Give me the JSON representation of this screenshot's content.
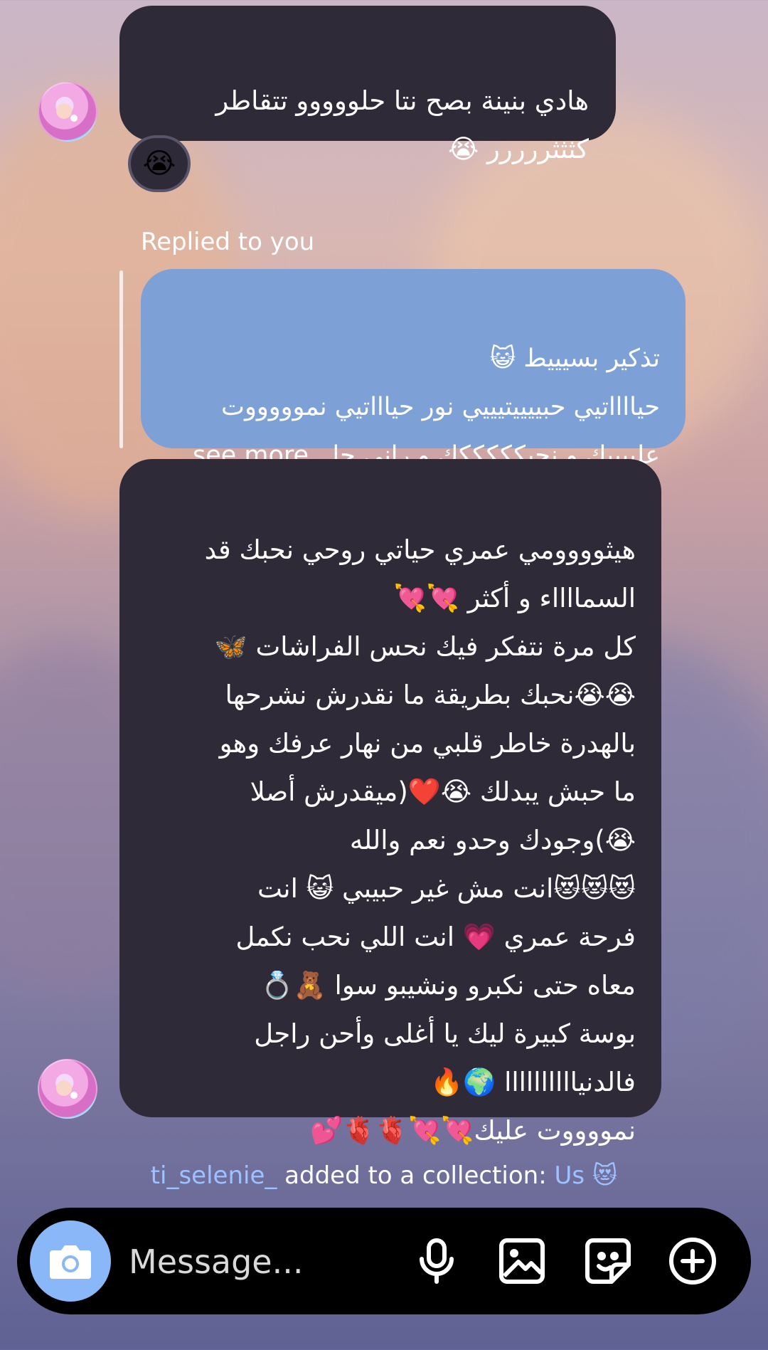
{
  "messages": {
    "first": "هادي بنينة بصح نتا حلووووو تتقاطر\nكثثثررررر 😭",
    "reaction": "😭",
    "replied_label": "Replied to you",
    "reply_preview": "تذكير بسيييط 😺\nحيااااتيي حبييييتيييي نور حياااتيي نموووووت\nعلييييك و نحبكككككك و راني حا...see more",
    "long_message": "هيثوووومي عمري حياتي روحي نحبك قد\nالسمااااء و أكثر 💘💘\nكل مرة نتفكر فيك نحس الفراشات 🦋\n😭😭نحبك بطريقة ما نقدرش نشرحها\nبالهدرة  خاطر قلبي من نهار عرفك وهو\nما حبش يبدلك 😭❤️(ميقدرش أصلا\n😭)وجودك وحدو نعم والله\n😻😻😻انت مش غير حبيبي 😺 انت\nفرحة عمري 💗 انت اللي نحب نكمل\nمعاه حتى نكبرو ونشيبو سوا 🧸💍\nبوسة كبيرة ليك يا أغلى وأحن راجل\nفالدنياااااااااا 🌍🔥\nنمووووت عليك💘💘🫀🫀💕"
  },
  "system": {
    "username": "ti_selenie_",
    "text": "added to a collection:",
    "collection": "Us 😻"
  },
  "composer": {
    "placeholder": "Message..."
  },
  "icons": [
    "camera-icon",
    "microphone-icon",
    "image-icon",
    "sticker-icon",
    "plus-circle-icon"
  ]
}
